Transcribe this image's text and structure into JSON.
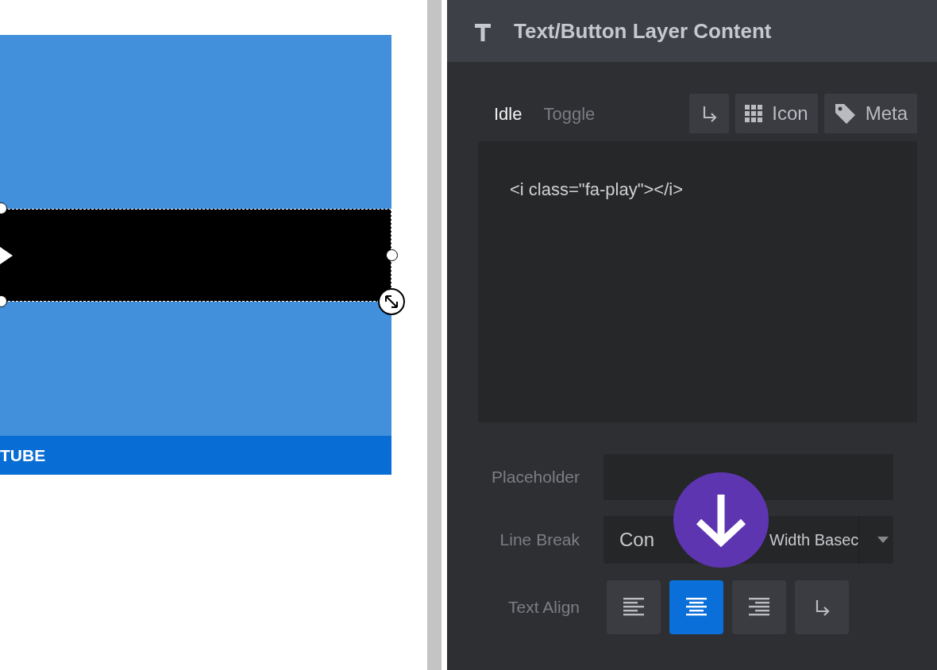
{
  "canvas": {
    "footer_text": "TUBE"
  },
  "panel": {
    "title": "Text/Button Layer Content",
    "tabs": [
      {
        "label": "Idle",
        "selected": true
      },
      {
        "label": "Toggle",
        "selected": false
      }
    ],
    "toolbar": [
      {
        "kind": "linebreak"
      },
      {
        "kind": "icon",
        "label": "Icon"
      },
      {
        "kind": "meta",
        "label": "Meta"
      }
    ],
    "editor": {
      "value": "<i class=\"fa-play\"></i>"
    },
    "placeholder_field": {
      "label": "Placeholder"
    },
    "line_break": {
      "label": "Line Break",
      "value_parts": [
        "Con",
        "Width Basec"
      ]
    },
    "text_align": {
      "label": "Text Align",
      "options": [
        {
          "kind": "left",
          "selected": false
        },
        {
          "kind": "center",
          "selected": true
        },
        {
          "kind": "right",
          "selected": false
        },
        {
          "kind": "linebreak",
          "selected": false
        }
      ]
    }
  }
}
